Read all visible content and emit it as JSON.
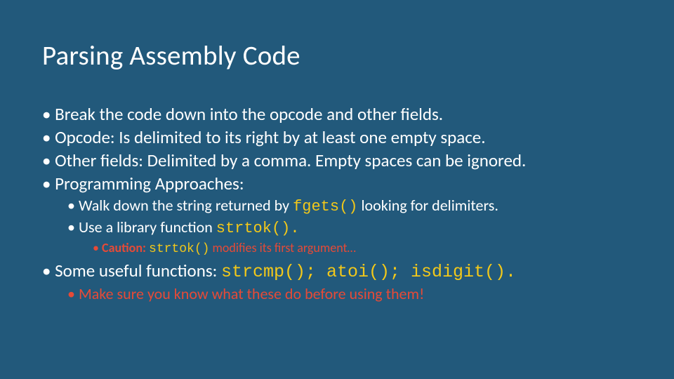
{
  "title": "Parsing Assembly Code",
  "bullets": {
    "b1": "Break the code down into the opcode and other fields.",
    "b2": "Opcode: Is delimited to its right by at least one empty space.",
    "b3": "Other fields: Delimited by a comma.  Empty spaces can be ignored.",
    "b4": "Programming Approaches:",
    "b4a_pre": "Walk down the string returned by ",
    "b4a_code": "fgets()",
    "b4a_post": " looking for delimiters.",
    "b4b_pre": "Use a library function ",
    "b4b_code": "strtok().",
    "b4b1_pre": "Caution: ",
    "b4b1_code": "strtok()",
    "b4b1_post": "  modifies its first argument…",
    "b5_pre": "Some useful functions: ",
    "b5_code": "strcmp(); atoi(); isdigit().",
    "b5a": "Make sure you know what these do before using them!"
  }
}
